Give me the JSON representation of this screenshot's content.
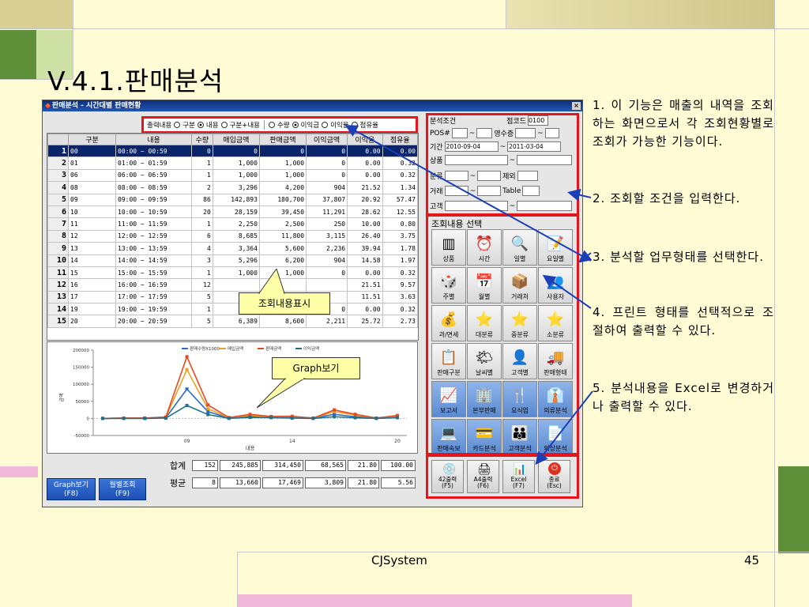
{
  "slide_title": "V.4.1.판매분석",
  "app": {
    "title": "판매분석 - 시간대별 판매현황",
    "close_label": "×",
    "options": {
      "label": "출력내용",
      "group1": [
        "구분",
        "내용",
        "구분+내용"
      ],
      "group2": [
        "수량",
        "이익금",
        "이익율",
        "점유율"
      ]
    },
    "grid": {
      "headers": [
        "구분",
        "내용",
        "수량",
        "매입금액",
        "판매금액",
        "이익금액",
        "이익율",
        "점유율"
      ],
      "rows": [
        [
          "1",
          "00",
          "00:00 ~ 00:59",
          "0",
          "0",
          "0",
          "0",
          "0.00",
          "0.00"
        ],
        [
          "2",
          "01",
          "01:00 ~ 01:59",
          "1",
          "1,000",
          "1,000",
          "0",
          "0.00",
          "0.32"
        ],
        [
          "3",
          "06",
          "06:00 ~ 06:59",
          "1",
          "1,000",
          "1,000",
          "0",
          "0.00",
          "0.32"
        ],
        [
          "4",
          "08",
          "08:00 ~ 08:59",
          "2",
          "3,296",
          "4,200",
          "904",
          "21.52",
          "1.34"
        ],
        [
          "5",
          "09",
          "09:00 ~ 09:59",
          "86",
          "142,893",
          "180,700",
          "37,807",
          "20.92",
          "57.47"
        ],
        [
          "6",
          "10",
          "10:00 ~ 10:59",
          "20",
          "28,159",
          "39,450",
          "11,291",
          "28.62",
          "12.55"
        ],
        [
          "7",
          "11",
          "11:00 ~ 11:59",
          "1",
          "2,250",
          "2,500",
          "250",
          "10.00",
          "0.80"
        ],
        [
          "8",
          "12",
          "12:00 ~ 12:59",
          "6",
          "8,685",
          "11,800",
          "3,115",
          "26.40",
          "3.75"
        ],
        [
          "9",
          "13",
          "13:00 ~ 13:59",
          "4",
          "3,364",
          "5,600",
          "2,236",
          "39.94",
          "1.78"
        ],
        [
          "10",
          "14",
          "14:00 ~ 14:59",
          "3",
          "5,296",
          "6,200",
          "904",
          "14.58",
          "1.97"
        ],
        [
          "11",
          "15",
          "15:00 ~ 15:59",
          "1",
          "1,000",
          "1,000",
          "0",
          "0.00",
          "0.32"
        ],
        [
          "12",
          "16",
          "16:00 ~ 16:59",
          "12",
          "",
          "",
          "",
          "21.51",
          "9.57"
        ],
        [
          "13",
          "17",
          "17:00 ~ 17:59",
          "5",
          "",
          "",
          "",
          "11.51",
          "3.63"
        ],
        [
          "14",
          "19",
          "19:00 ~ 19:59",
          "1",
          "1,000",
          "1,000",
          "0",
          "0.00",
          "0.32"
        ],
        [
          "15",
          "20",
          "20:00 ~ 20:59",
          "5",
          "6,389",
          "8,600",
          "2,211",
          "25.72",
          "2.73"
        ]
      ]
    },
    "totals": {
      "sum_label": "합계",
      "sum": [
        "152",
        "245,885",
        "314,450",
        "68,565",
        "21.80",
        "100.00"
      ],
      "avg_label": "평균",
      "avg": [
        "8",
        "13,660",
        "17,469",
        "3,809",
        "21.80",
        "5.56"
      ]
    },
    "buttons": {
      "graph": "Graph보기\n(F8)",
      "monthly": "월별조회\n(F9)"
    },
    "conditions": {
      "title": "분석조건",
      "store_code_label": "점코드",
      "store_code": "0100",
      "pos_label": "POS#",
      "receipt_label": "영수증",
      "period_label": "기간",
      "date_from": "2010-09-04",
      "date_to": "2011-03-04",
      "product_label": "상품",
      "category_label": "분류",
      "exclude_label": "제외",
      "partner_label": "거래",
      "table_label": "Table",
      "customer_label": "고객"
    },
    "select_title": "조회내용 선택",
    "select_items": [
      "상품",
      "시간",
      "일별",
      "요일별",
      "주별",
      "월별",
      "거래처",
      "사용자",
      "과/면세",
      "대분류",
      "중분류",
      "소분류",
      "판매구분",
      "날씨별",
      "고객별",
      "판매형태",
      "보고서",
      "본부판매",
      "요식업",
      "의류분석",
      "판매속보",
      "카드분석",
      "고객분석",
      "외상분석"
    ],
    "print_items": [
      "42출력\n(F5)",
      "A4출력\n(F6)",
      "Excel\n(F7)",
      "종료\n(Esc)"
    ]
  },
  "chart_data": {
    "type": "line",
    "legend": [
      "판매수량X1000",
      "매입금액",
      "판매금액",
      "이익금액"
    ],
    "xlabel": "내용",
    "ylabel": "금액",
    "x": [
      "00",
      "01",
      "06",
      "08",
      "09",
      "10",
      "11",
      "12",
      "13",
      "14",
      "15",
      "16",
      "17",
      "19",
      "20"
    ],
    "x_tick_labels": [
      "09",
      "14",
      "20"
    ],
    "ylim": [
      -50000,
      200000
    ],
    "y_ticks": [
      "200000",
      "150000",
      "100000",
      "50000",
      "0",
      "-50000"
    ],
    "series": [
      {
        "name": "판매수량X1000",
        "values": [
          0,
          1000,
          1000,
          2000,
          86000,
          20000,
          1000,
          6000,
          4000,
          3000,
          1000,
          12000,
          5000,
          1000,
          5000
        ]
      },
      {
        "name": "매입금액",
        "values": [
          0,
          1000,
          1000,
          3296,
          142893,
          28159,
          2250,
          8685,
          3364,
          5296,
          1000,
          20000,
          10000,
          1000,
          6389
        ]
      },
      {
        "name": "판매금액",
        "values": [
          0,
          1000,
          1000,
          4200,
          180700,
          39450,
          2500,
          11800,
          5600,
          6200,
          1000,
          25000,
          12000,
          1000,
          8600
        ]
      },
      {
        "name": "이익금액",
        "values": [
          0,
          0,
          0,
          904,
          37807,
          11291,
          250,
          3115,
          2236,
          904,
          0,
          5000,
          2000,
          0,
          2211
        ]
      }
    ],
    "colors": [
      "#2a6cc8",
      "#f0a020",
      "#e84a20",
      "#1e6f8e"
    ]
  },
  "callouts": {
    "grid": "조회내용표시",
    "graph": "Graph보기"
  },
  "descriptions": [
    "1. 이 기능은 매출의 내역을 조회하는 화면으로서 각 조회현황별로 조회가 가능한 기능이다.",
    "2. 조회할 조건을 입력한다.",
    "3. 분석할 업무형태를 선택한다.",
    "4. 프린트 형태를 선택적으로 조절하여 출력할 수 있다.",
    "5. 분석내용을 Excel로 변경하거나 출력할 수 있다."
  ],
  "footer": {
    "company": "CJSystem",
    "page": "45"
  }
}
